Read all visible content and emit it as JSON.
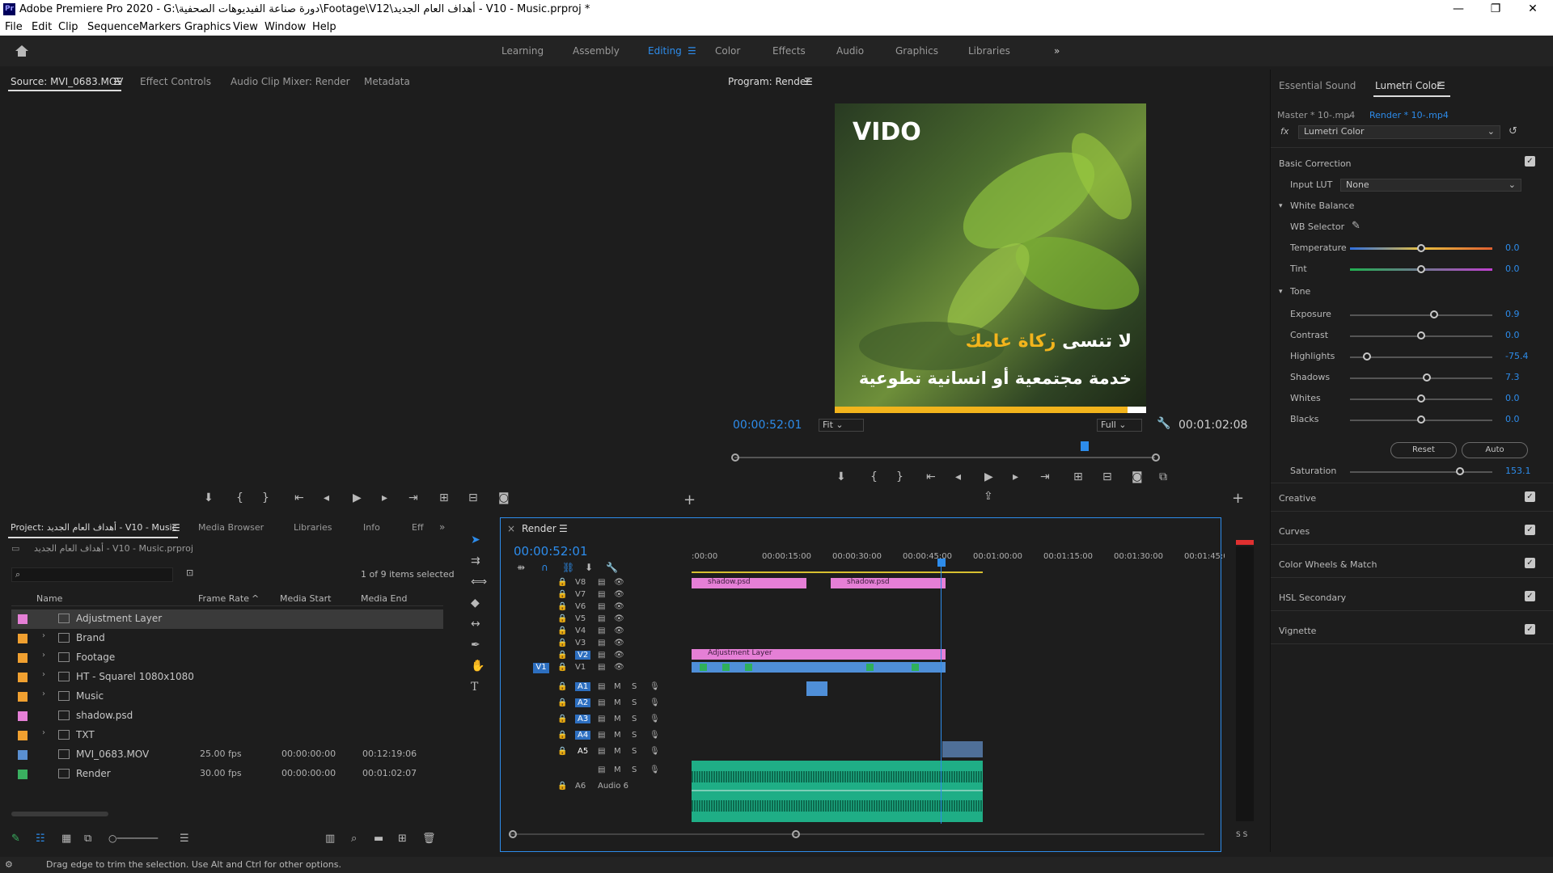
{
  "app": {
    "title": "Adobe Premiere Pro 2020 - G:\\دورة صناعة الفيديوهات الصحفية\\Footage\\V12\\أهداف العام الجديد - V10 - Music.prproj *",
    "window_controls": [
      "—",
      "❐",
      "✕"
    ]
  },
  "menu": [
    "File",
    "Edit",
    "Clip",
    "Sequence",
    "Markers",
    "Graphics",
    "View",
    "Window",
    "Help"
  ],
  "workspaces": [
    "Learning",
    "Assembly",
    "Editing",
    "Color",
    "Effects",
    "Audio",
    "Graphics",
    "Libraries"
  ],
  "workspace_more": "»",
  "source_panel": {
    "tabs": [
      "Source: MVI_0683.MOV",
      "Effect Controls",
      "Audio Clip Mixer: Render",
      "Metadata"
    ],
    "add": "+"
  },
  "program_panel": {
    "title": "Program: Render",
    "timecode": "00:00:52:01",
    "fit": "Fit",
    "quality": "Full",
    "duration": "00:01:02:08",
    "add": "+"
  },
  "video": {
    "logo": "VIDO",
    "line1_white": "لا تنسى",
    "line1_yellow": "زكاة عامك",
    "line2": "خدمة مجتمعية أو انسانية تطوعية",
    "progress": 0.94
  },
  "project_panel": {
    "tabs": [
      "Project: أهداف العام الجديد - V10 - Music",
      "Media Browser",
      "Libraries",
      "Info",
      "Eff"
    ],
    "more": "»",
    "file": "أهداف العام الجديد - V10 - Music.prproj",
    "count": "1 of 9 items selected",
    "columns": [
      "Name",
      "Frame Rate",
      "Media Start",
      "Media End"
    ],
    "items": [
      {
        "name": "Adjustment Layer",
        "color": "#e57fd6",
        "folder": false,
        "fps": "",
        "start": "",
        "end": "",
        "selected": true
      },
      {
        "name": "Brand",
        "color": "#f0a030",
        "folder": true,
        "fps": "",
        "start": "",
        "end": ""
      },
      {
        "name": "Footage",
        "color": "#f0a030",
        "folder": true,
        "fps": "",
        "start": "",
        "end": ""
      },
      {
        "name": "HT - Squarel 1080x1080",
        "color": "#f0a030",
        "folder": true,
        "fps": "",
        "start": "",
        "end": ""
      },
      {
        "name": "Music",
        "color": "#f0a030",
        "folder": true,
        "fps": "",
        "start": "",
        "end": ""
      },
      {
        "name": "shadow.psd",
        "color": "#e57fd6",
        "folder": false,
        "fps": "",
        "start": "",
        "end": ""
      },
      {
        "name": "TXT",
        "color": "#f0a030",
        "folder": true,
        "fps": "",
        "start": "",
        "end": ""
      },
      {
        "name": "MVI_0683.MOV",
        "color": "#5a8fd0",
        "folder": false,
        "fps": "25.00 fps",
        "start": "00:00:00:00",
        "end": "00:12:19:06"
      },
      {
        "name": "Render",
        "color": "#3ab060",
        "folder": false,
        "fps": "30.00 fps",
        "start": "00:00:00:00",
        "end": "00:01:02:07"
      }
    ]
  },
  "timeline": {
    "tab": "Render",
    "timecode": "00:00:52:01",
    "ruler": [
      ":00:00",
      "00:00:15:00",
      "00:00:30:00",
      "00:00:45:00",
      "00:01:00:00",
      "00:01:15:00",
      "00:01:30:00",
      "00:01:45:00"
    ],
    "video_tracks": [
      "V8",
      "V7",
      "V6",
      "V5",
      "V4",
      "V3",
      "V2",
      "V1"
    ],
    "audio_tracks": [
      "A1",
      "A2",
      "A3",
      "A4",
      "A5"
    ],
    "audio6": "A6",
    "audio6_name": "Audio 6",
    "clips": {
      "shadow": "shadow.psd",
      "adjustment": "Adjustment Layer"
    },
    "meter_solo": "S S"
  },
  "lumetri": {
    "tabs": [
      "Essential Sound",
      "Lumetri Color"
    ],
    "master": "Master * 10-.mp4",
    "render": "Render * 10-.mp4",
    "fx": "fx",
    "effect": "Lumetri Color",
    "basic": "Basic Correction",
    "input_lut_label": "Input LUT",
    "input_lut": "None",
    "white_balance": "White Balance",
    "wb_selector": "WB Selector",
    "temperature": {
      "label": "Temperature",
      "value": "0.0",
      "pos": 0.5
    },
    "tint": {
      "label": "Tint",
      "value": "0.0",
      "pos": 0.5
    },
    "tone": "Tone",
    "sliders": [
      {
        "label": "Exposure",
        "value": "0.9",
        "pos": 0.59
      },
      {
        "label": "Contrast",
        "value": "0.0",
        "pos": 0.5
      },
      {
        "label": "Highlights",
        "value": "-75.4",
        "pos": 0.12
      },
      {
        "label": "Shadows",
        "value": "7.3",
        "pos": 0.54
      },
      {
        "label": "Whites",
        "value": "0.0",
        "pos": 0.5
      },
      {
        "label": "Blacks",
        "value": "0.0",
        "pos": 0.5
      }
    ],
    "reset": "Reset",
    "auto": "Auto",
    "saturation": {
      "label": "Saturation",
      "value": "153.1",
      "pos": 0.77
    },
    "sections": [
      "Creative",
      "Curves",
      "Color Wheels & Match",
      "HSL Secondary",
      "Vignette"
    ]
  },
  "status": "Drag edge to trim the selection. Use Alt and Ctrl for other options.",
  "colors": {
    "accent": "#2d8ceb",
    "shadow_clip": "#e57fd6",
    "video_clip": "#4f8fd8",
    "audio_clip": "#1fae86",
    "playhead": "#2d8ceb"
  }
}
